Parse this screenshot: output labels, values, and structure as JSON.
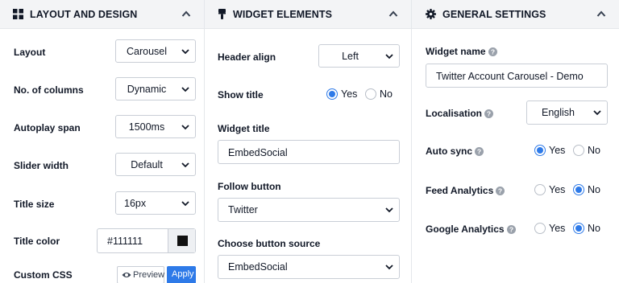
{
  "layout_panel": {
    "title": "LAYOUT AND DESIGN",
    "layout": {
      "label": "Layout",
      "value": "Carousel"
    },
    "columns": {
      "label": "No. of columns",
      "value": "Dynamic"
    },
    "autoplay": {
      "label": "Autoplay span",
      "value": "1500ms"
    },
    "slider_width": {
      "label": "Slider width",
      "value": "Default"
    },
    "title_size": {
      "label": "Title size",
      "value": "16px"
    },
    "title_color": {
      "label": "Title color",
      "value": "#111111",
      "swatch": "#111111"
    },
    "custom_css": {
      "label": "Custom CSS",
      "preview_label": "Preview",
      "apply_label": "Apply"
    }
  },
  "widget_panel": {
    "title": "WIDGET ELEMENTS",
    "header_align": {
      "label": "Header align",
      "value": "Left"
    },
    "show_title": {
      "label": "Show title",
      "yes": "Yes",
      "no": "No",
      "selected": "Yes"
    },
    "widget_title": {
      "label": "Widget title",
      "value": "EmbedSocial"
    },
    "follow_button": {
      "label": "Follow button",
      "value": "Twitter"
    },
    "button_source": {
      "label": "Choose button source",
      "value": "EmbedSocial"
    }
  },
  "general_panel": {
    "title": "GENERAL SETTINGS",
    "widget_name": {
      "label": "Widget name",
      "value": "Twitter Account Carousel - Demo"
    },
    "localisation": {
      "label": "Localisation",
      "value": "English"
    },
    "auto_sync": {
      "label": "Auto sync",
      "yes": "Yes",
      "no": "No",
      "selected": "Yes"
    },
    "feed_analytics": {
      "label": "Feed Analytics",
      "yes": "Yes",
      "no": "No",
      "selected": "No"
    },
    "google_analytics": {
      "label": "Google Analytics",
      "yes": "Yes",
      "no": "No",
      "selected": "No"
    }
  },
  "colors": {
    "accent": "#2e7ae8",
    "header_bg": "#f3f4f6",
    "border": "#c9ced6"
  }
}
